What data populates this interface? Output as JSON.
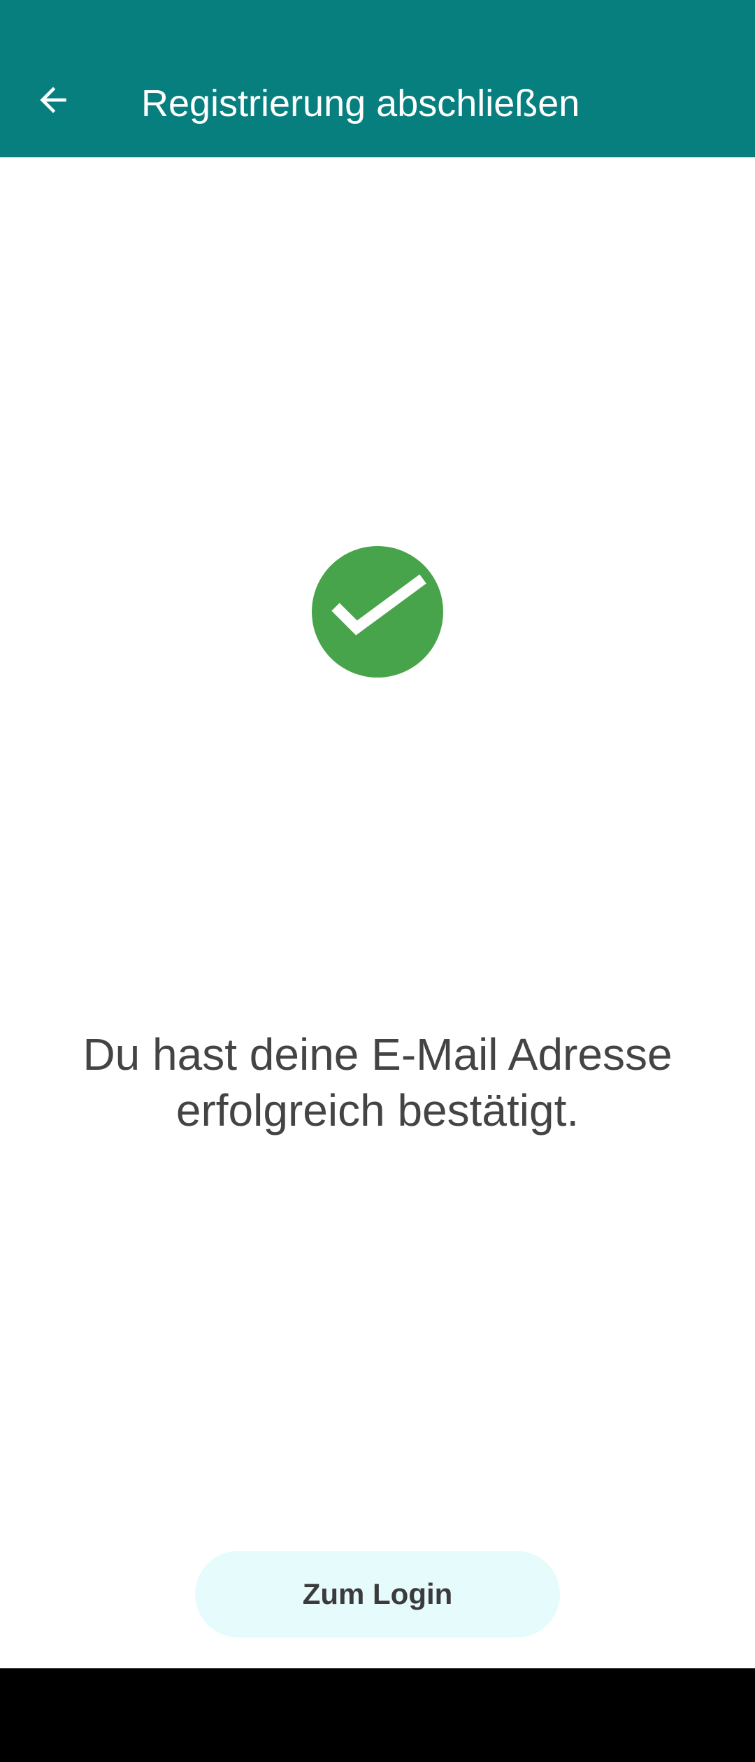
{
  "app_bar": {
    "title": "Registrierung abschließen",
    "back_icon": "arrow-left-icon",
    "background_color": "#077f7f"
  },
  "main": {
    "success_icon": "check-circle-icon",
    "success_color": "#47a44b",
    "message_line1": "Du hast deine E-Mail Adresse",
    "message_line2": "erfolgreich bestätigt."
  },
  "footer": {
    "login_label": "Zum Login",
    "button_color": "#e6fbfc"
  }
}
